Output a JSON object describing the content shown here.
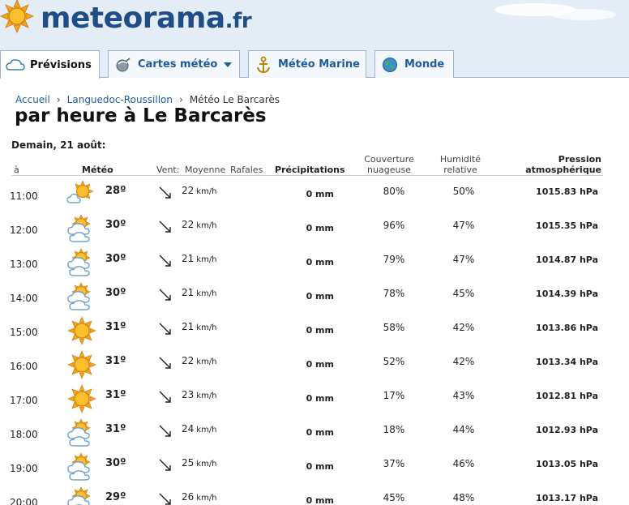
{
  "site": {
    "name": "meteorama",
    "tld": ".fr"
  },
  "tabs": [
    {
      "label": "Prévisions",
      "icon": "cloud-icon",
      "active": true
    },
    {
      "label": "Cartes météo",
      "icon": "satellite-icon",
      "dropdown": true
    },
    {
      "label": "Météo Marine",
      "icon": "anchor-icon"
    },
    {
      "label": "Monde",
      "icon": "globe-icon"
    }
  ],
  "breadcrumb": [
    "Accueil",
    "Languedoc-Roussillon",
    "Météo Le Barcarès"
  ],
  "page_title": "par heure à Le Barcarès",
  "day_title": "Demain, 21 août:",
  "columns": {
    "time": "à",
    "weather": "Météo",
    "wind_label": "Vent:",
    "wind_avg": "Moyenne",
    "wind_gusts": "Rafales",
    "precip": "Précipitations",
    "cloud_line1": "Couverture",
    "cloud_line2": "nuageuse",
    "hum_line1": "Humidité",
    "hum_line2": "relative",
    "press_line1": "Pression",
    "press_line2": "atmosphérique"
  },
  "rows": [
    {
      "time": "11:00",
      "icon": "partly-sunny-icon",
      "temp": "28º",
      "wind": "22",
      "wind_unit": "km/h",
      "precip": "0 mm",
      "cloud": "80%",
      "hum": "50%",
      "press": "1015.83 hPa"
    },
    {
      "time": "12:00",
      "icon": "sun-behind-cloud-icon",
      "temp": "30º",
      "wind": "22",
      "wind_unit": "km/h",
      "precip": "0 mm",
      "cloud": "96%",
      "hum": "47%",
      "press": "1015.35 hPa"
    },
    {
      "time": "13:00",
      "icon": "sun-behind-cloud-icon",
      "temp": "30º",
      "wind": "21",
      "wind_unit": "km/h",
      "precip": "0 mm",
      "cloud": "79%",
      "hum": "47%",
      "press": "1014.87 hPa"
    },
    {
      "time": "14:00",
      "icon": "sun-behind-cloud-icon",
      "temp": "30º",
      "wind": "21",
      "wind_unit": "km/h",
      "precip": "0 mm",
      "cloud": "78%",
      "hum": "45%",
      "press": "1014.39 hPa"
    },
    {
      "time": "15:00",
      "icon": "sun-icon",
      "temp": "31º",
      "wind": "21",
      "wind_unit": "km/h",
      "precip": "0 mm",
      "cloud": "58%",
      "hum": "42%",
      "press": "1013.86 hPa"
    },
    {
      "time": "16:00",
      "icon": "sun-icon",
      "temp": "31º",
      "wind": "22",
      "wind_unit": "km/h",
      "precip": "0 mm",
      "cloud": "52%",
      "hum": "42%",
      "press": "1013.34 hPa"
    },
    {
      "time": "17:00",
      "icon": "sun-icon",
      "temp": "31º",
      "wind": "23",
      "wind_unit": "km/h",
      "precip": "0 mm",
      "cloud": "17%",
      "hum": "43%",
      "press": "1012.81 hPa"
    },
    {
      "time": "18:00",
      "icon": "sun-behind-cloud-icon",
      "temp": "31º",
      "wind": "24",
      "wind_unit": "km/h",
      "precip": "0 mm",
      "cloud": "18%",
      "hum": "44%",
      "press": "1012.93 hPa"
    },
    {
      "time": "19:00",
      "icon": "sun-behind-cloud-icon",
      "temp": "30º",
      "wind": "25",
      "wind_unit": "km/h",
      "precip": "0 mm",
      "cloud": "37%",
      "hum": "46%",
      "press": "1013.05 hPa"
    },
    {
      "time": "20:00",
      "icon": "sun-behind-cloud-icon",
      "temp": "29º",
      "wind": "26",
      "wind_unit": "km/h",
      "precip": "0 mm",
      "cloud": "45%",
      "hum": "48%",
      "press": "1013.17 hPa"
    }
  ],
  "colors": {
    "brand": "#1f4d86",
    "link": "#1f5c9b",
    "sun": "#f5a31a",
    "header_bg": "#e4edf6"
  }
}
